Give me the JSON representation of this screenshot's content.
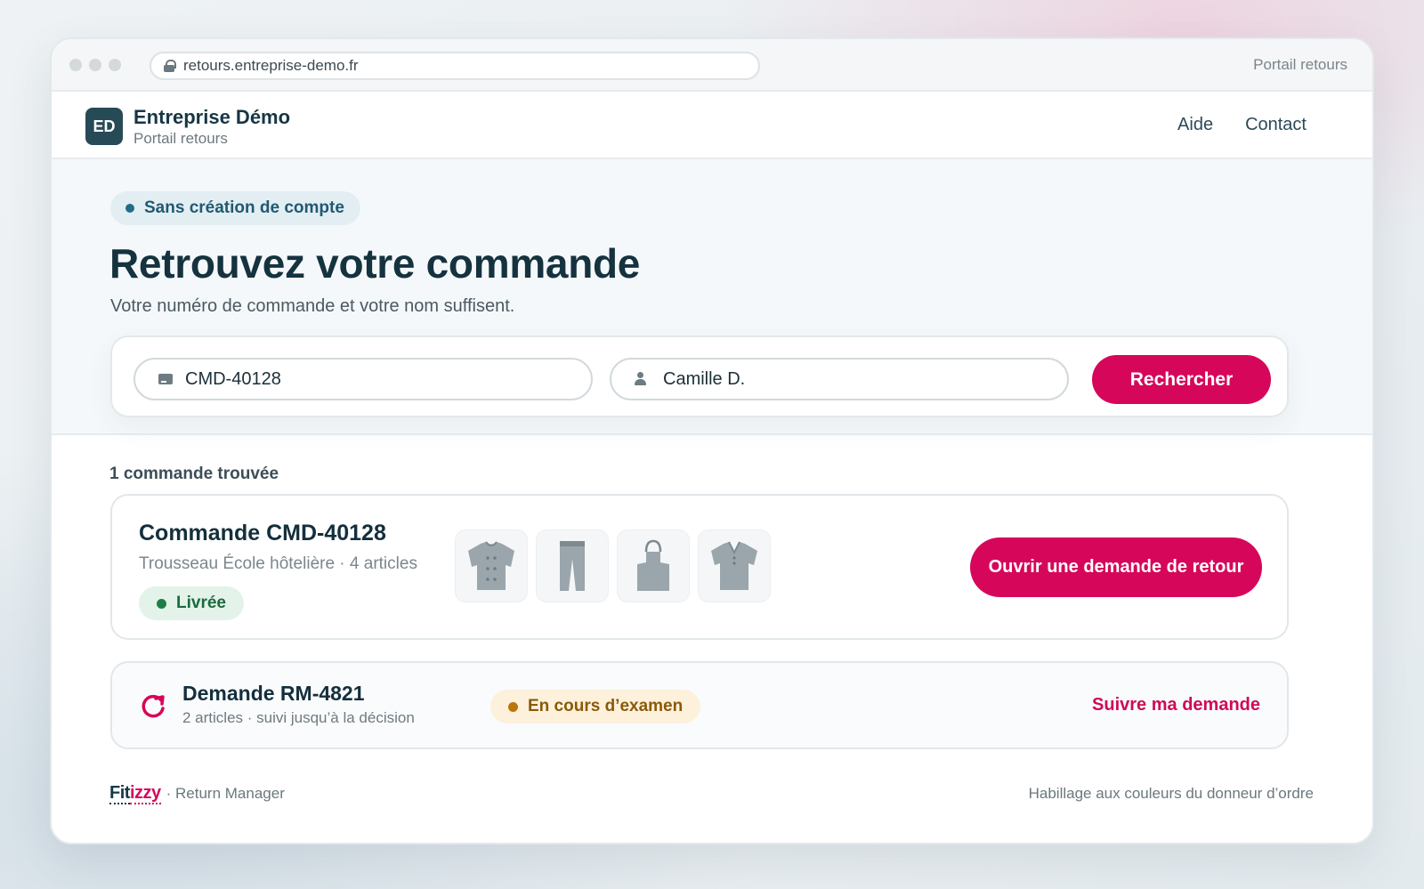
{
  "browser": {
    "url": "retours.entreprise-demo.fr",
    "tab_label": "Portail retours"
  },
  "header": {
    "logo_initials": "ED",
    "company_name": "Entreprise Démo",
    "portal_name": "Portail retours",
    "nav": [
      "Aide",
      "Contact"
    ]
  },
  "hero": {
    "badge": "Sans création de compte",
    "title": "Retrouvez votre commande",
    "subtitle": "Votre numéro de commande et votre nom suffisent.",
    "order_field_value": "CMD-40128",
    "name_field_value": "Camille D.",
    "search_button": "Rechercher"
  },
  "results": {
    "count_label": "1 commande trouvée",
    "order": {
      "title": "Commande CMD-40128",
      "subtitle": "Trousseau École hôtelière · 4 articles",
      "status": "Livrée",
      "status_color": "#1f7e48",
      "items": [
        "chef-jacket-icon",
        "trousers-icon",
        "apron-icon",
        "tunic-icon"
      ],
      "cta": "Ouvrir une demande de retour"
    },
    "request": {
      "title": "Demande RM-4821",
      "subtitle": "2 articles · suivi jusqu’à la décision",
      "status": "En cours d’examen",
      "status_color": "#b8760b",
      "link": "Suivre ma demande"
    }
  },
  "footer": {
    "brand_part1": "Fit",
    "brand_part2": "izzy",
    "tagline": "· Return Manager",
    "note": "Habillage aux couleurs du donneur d’ordre"
  },
  "colors": {
    "accent": "#d6075a",
    "primary": "#274a57"
  }
}
